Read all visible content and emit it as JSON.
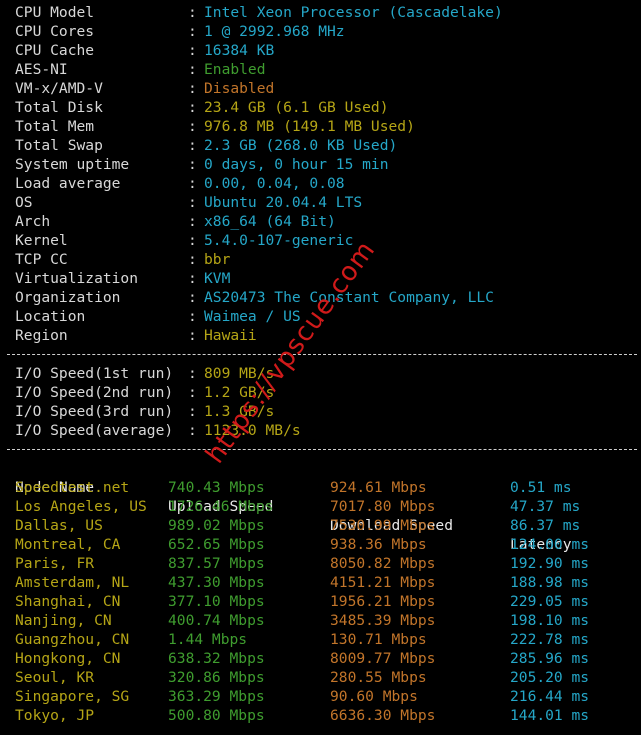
{
  "sysinfo": [
    {
      "key": "CPU Model",
      "value": "Intel Xeon Processor (Cascadelake)",
      "color": "cyan"
    },
    {
      "key": "CPU Cores",
      "value": "1 @ 2992.968 MHz",
      "color": "cyan"
    },
    {
      "key": "CPU Cache",
      "value": "16384 KB",
      "color": "cyan"
    },
    {
      "key": "AES-NI",
      "value": "Enabled",
      "color": "green"
    },
    {
      "key": "VM-x/AMD-V",
      "value": "Disabled",
      "color": "orange"
    },
    {
      "key": "Total Disk",
      "value": "23.4 GB (6.1 GB Used)",
      "color": "yellow"
    },
    {
      "key": "Total Mem",
      "value": "976.8 MB (149.1 MB Used)",
      "color": "yellow"
    },
    {
      "key": "Total Swap",
      "value": "2.3 GB (268.0 KB Used)",
      "color": "cyan"
    },
    {
      "key": "System uptime",
      "value": "0 days, 0 hour 15 min",
      "color": "cyan"
    },
    {
      "key": "Load average",
      "value": "0.00, 0.04, 0.08",
      "color": "cyan"
    },
    {
      "key": "OS",
      "value": "Ubuntu 20.04.4 LTS",
      "color": "cyan"
    },
    {
      "key": "Arch",
      "value": "x86_64 (64 Bit)",
      "color": "cyan"
    },
    {
      "key": "Kernel",
      "value": "5.4.0-107-generic",
      "color": "cyan"
    },
    {
      "key": "TCP CC",
      "value": "bbr",
      "color": "yellow"
    },
    {
      "key": "Virtualization",
      "value": "KVM",
      "color": "cyan"
    },
    {
      "key": "Organization",
      "value": "AS20473 The Constant Company, LLC",
      "color": "cyan"
    },
    {
      "key": "Location",
      "value": "Waimea / US",
      "color": "cyan"
    },
    {
      "key": "Region",
      "value": "Hawaii",
      "color": "yellow"
    }
  ],
  "io": [
    {
      "key": "I/O Speed(1st run)",
      "value": "809 MB/s",
      "color": "yellow"
    },
    {
      "key": "I/O Speed(2nd run)",
      "value": "1.2 GB/s",
      "color": "yellow"
    },
    {
      "key": "I/O Speed(3rd run)",
      "value": "1.3 GB/s",
      "color": "yellow"
    },
    {
      "key": "I/O Speed(average)",
      "value": "1123.0 MB/s",
      "color": "yellow"
    }
  ],
  "separator": ":",
  "speedtest": {
    "headers": [
      "Node Name",
      "Upload Speed",
      "Download Speed",
      "Latency"
    ],
    "rows": [
      [
        "Speedtest.net",
        "740.43 Mbps",
        "924.61 Mbps",
        "0.51 ms"
      ],
      [
        "Los Angeles, US",
        "1726.46 Mbps",
        "7017.80 Mbps",
        "47.37 ms"
      ],
      [
        "Dallas, US",
        "989.02 Mbps",
        "7530.99 Mbps",
        "86.37 ms"
      ],
      [
        "Montreal, CA",
        "652.65 Mbps",
        "938.36 Mbps",
        "124.00 ms"
      ],
      [
        "Paris, FR",
        "837.57 Mbps",
        "8050.82 Mbps",
        "192.90 ms"
      ],
      [
        "Amsterdam, NL",
        "437.30 Mbps",
        "4151.21 Mbps",
        "188.98 ms"
      ],
      [
        "Shanghai, CN",
        "377.10 Mbps",
        "1956.21 Mbps",
        "229.05 ms"
      ],
      [
        "Nanjing, CN",
        "400.74 Mbps",
        "3485.39 Mbps",
        "198.10 ms"
      ],
      [
        "Guangzhou, CN",
        "1.44 Mbps",
        "130.71 Mbps",
        "222.78 ms"
      ],
      [
        "Hongkong, CN",
        "638.32 Mbps",
        "8009.77 Mbps",
        "285.96 ms"
      ],
      [
        "Seoul, KR",
        "320.86 Mbps",
        "280.55 Mbps",
        "205.20 ms"
      ],
      [
        "Singapore, SG",
        "363.29 Mbps",
        "90.60 Mbps",
        "216.44 ms"
      ],
      [
        "Tokyo, JP",
        "500.80 Mbps",
        "6636.30 Mbps",
        "144.01 ms"
      ]
    ]
  },
  "watermark": "https://vpscue.com",
  "colors": {
    "background": "#000000",
    "label": "#d8d8d8",
    "cyan": "#25a7c8",
    "yellow": "#b5a516",
    "green": "#3f9d2f",
    "orange": "#c2752a",
    "watermark": "#d01a1a"
  }
}
